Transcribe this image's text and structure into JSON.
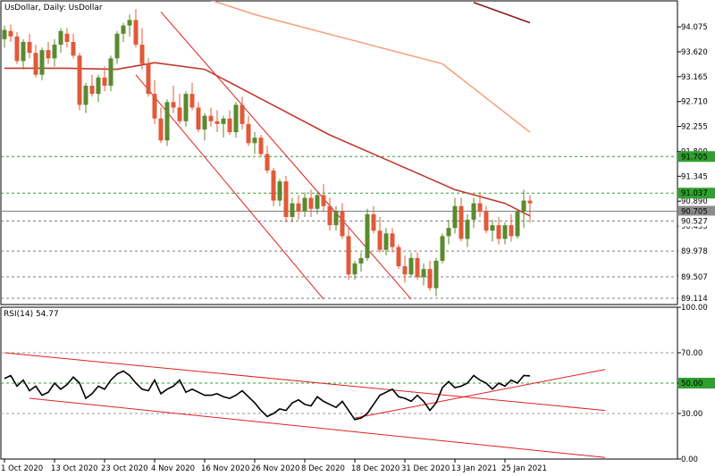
{
  "chart_data": [
    {
      "type": "candlestick",
      "title": "UsDollar, Daily:  UsDollar",
      "ylim": [
        89.0,
        94.55
      ],
      "y_ticks": [
        "94.075",
        "93.620",
        "93.165",
        "92.710",
        "92.255",
        "91.800",
        "91.345",
        "90.890",
        "90.435",
        "89.980",
        "89.525",
        "89.114"
      ],
      "price_labels": [
        {
          "label": "91.705",
          "style": "green-box"
        },
        {
          "label": "91.037",
          "style": "green-box"
        },
        {
          "label": "90.705",
          "style": "gray-box"
        },
        {
          "label": "90.527",
          "style": "plain"
        },
        {
          "label": "89.978",
          "style": "plain"
        },
        {
          "label": "89.507",
          "style": "plain"
        },
        {
          "label": "89.114",
          "style": "plain"
        }
      ],
      "x_ticks": [
        "1 Oct 2020",
        "13 Oct 2020",
        "23 Oct 2020",
        "4 Nov 2020",
        "16 Nov 2020",
        "26 Nov 2020",
        "8 Dec 2020",
        "18 Dec 2020",
        "31 Dec 2020",
        "13 Jan 2021",
        "25 Jan 2021"
      ],
      "tick_indices": [
        0,
        8,
        16,
        24,
        32,
        40,
        48,
        56,
        64,
        72,
        80
      ],
      "up_color": "#5a8a2f",
      "down_color": "#e05a3a",
      "candles": [
        [
          93.85,
          94.1,
          93.7,
          94.02
        ],
        [
          94.0,
          94.12,
          93.8,
          93.9
        ],
        [
          93.9,
          93.98,
          93.4,
          93.45
        ],
        [
          93.45,
          93.85,
          93.3,
          93.8
        ],
        [
          93.8,
          93.95,
          93.5,
          93.6
        ],
        [
          93.6,
          93.75,
          93.15,
          93.2
        ],
        [
          93.2,
          93.7,
          93.1,
          93.65
        ],
        [
          93.65,
          93.8,
          93.4,
          93.5
        ],
        [
          93.5,
          93.85,
          93.35,
          93.75
        ],
        [
          93.75,
          94.05,
          93.6,
          94.0
        ],
        [
          93.95,
          94.05,
          93.7,
          93.8
        ],
        [
          93.8,
          93.95,
          93.5,
          93.55
        ],
        [
          93.55,
          93.6,
          92.55,
          92.65
        ],
        [
          92.65,
          93.05,
          92.5,
          93.0
        ],
        [
          93.0,
          93.2,
          92.8,
          92.85
        ],
        [
          92.85,
          93.2,
          92.7,
          93.15
        ],
        [
          93.15,
          93.35,
          92.9,
          93.0
        ],
        [
          93.0,
          93.55,
          92.9,
          93.5
        ],
        [
          93.5,
          94.0,
          93.4,
          93.95
        ],
        [
          93.95,
          94.15,
          93.8,
          94.1
        ],
        [
          94.1,
          94.3,
          93.9,
          94.2
        ],
        [
          94.2,
          94.4,
          93.7,
          93.75
        ],
        [
          93.75,
          94.05,
          93.3,
          93.4
        ],
        [
          93.4,
          93.5,
          92.8,
          92.85
        ],
        [
          92.85,
          93.1,
          92.3,
          92.4
        ],
        [
          92.4,
          92.6,
          91.95,
          92.0
        ],
        [
          92.0,
          92.75,
          91.9,
          92.7
        ],
        [
          92.7,
          93.0,
          92.5,
          92.6
        ],
        [
          92.6,
          92.85,
          92.3,
          92.35
        ],
        [
          92.35,
          92.9,
          92.25,
          92.85
        ],
        [
          92.85,
          93.05,
          92.55,
          92.6
        ],
        [
          92.6,
          92.7,
          92.15,
          92.2
        ],
        [
          92.2,
          92.5,
          92.0,
          92.45
        ],
        [
          92.45,
          92.6,
          92.25,
          92.35
        ],
        [
          92.35,
          92.55,
          92.15,
          92.3
        ],
        [
          92.3,
          92.45,
          92.05,
          92.4
        ],
        [
          92.4,
          92.55,
          92.1,
          92.15
        ],
        [
          92.15,
          92.7,
          92.05,
          92.65
        ],
        [
          92.65,
          92.8,
          92.2,
          92.3
        ],
        [
          92.3,
          92.45,
          91.9,
          91.95
        ],
        [
          91.95,
          92.15,
          91.75,
          92.05
        ],
        [
          92.05,
          92.1,
          91.7,
          91.75
        ],
        [
          91.75,
          91.9,
          91.4,
          91.45
        ],
        [
          91.45,
          91.5,
          90.8,
          90.9
        ],
        [
          90.9,
          91.3,
          90.8,
          91.25
        ],
        [
          91.25,
          91.35,
          90.5,
          90.6
        ],
        [
          90.6,
          90.95,
          90.5,
          90.85
        ],
        [
          90.85,
          91.0,
          90.55,
          90.7
        ],
        [
          90.7,
          91.05,
          90.6,
          90.95
        ],
        [
          90.95,
          91.1,
          90.6,
          90.75
        ],
        [
          90.75,
          91.05,
          90.65,
          91.0
        ],
        [
          91.0,
          91.2,
          90.7,
          90.8
        ],
        [
          90.8,
          90.95,
          90.35,
          90.45
        ],
        [
          90.45,
          90.8,
          90.35,
          90.7
        ],
        [
          90.7,
          90.85,
          90.2,
          90.25
        ],
        [
          90.25,
          90.4,
          89.45,
          89.55
        ],
        [
          89.55,
          89.8,
          89.45,
          89.75
        ],
        [
          89.75,
          89.95,
          89.6,
          89.85
        ],
        [
          89.85,
          90.75,
          89.8,
          90.65
        ],
        [
          90.65,
          90.8,
          90.3,
          90.35
        ],
        [
          90.35,
          90.6,
          89.95,
          90.0
        ],
        [
          90.0,
          90.4,
          89.9,
          90.3
        ],
        [
          90.3,
          90.4,
          89.95,
          90.05
        ],
        [
          90.05,
          90.1,
          89.65,
          89.7
        ],
        [
          89.7,
          89.9,
          89.4,
          89.55
        ],
        [
          89.55,
          89.95,
          89.5,
          89.85
        ],
        [
          89.85,
          89.95,
          89.45,
          89.5
        ],
        [
          89.5,
          89.75,
          89.35,
          89.65
        ],
        [
          89.65,
          89.8,
          89.25,
          89.3
        ],
        [
          89.3,
          89.85,
          89.15,
          89.8
        ],
        [
          89.8,
          90.3,
          89.75,
          90.25
        ],
        [
          90.25,
          90.55,
          90.1,
          90.4
        ],
        [
          90.4,
          90.95,
          90.3,
          90.8
        ],
        [
          90.8,
          90.95,
          90.15,
          90.2
        ],
        [
          90.2,
          90.65,
          90.05,
          90.55
        ],
        [
          90.55,
          90.95,
          90.4,
          90.85
        ],
        [
          90.85,
          91.05,
          90.6,
          90.7
        ],
        [
          90.7,
          90.8,
          90.3,
          90.35
        ],
        [
          90.35,
          90.55,
          90.15,
          90.45
        ],
        [
          90.45,
          90.6,
          90.1,
          90.2
        ],
        [
          90.2,
          90.5,
          90.1,
          90.45
        ],
        [
          90.45,
          90.65,
          90.15,
          90.25
        ],
        [
          90.25,
          90.75,
          90.2,
          90.7
        ],
        [
          90.7,
          91.1,
          90.4,
          90.9
        ],
        [
          90.9,
          91.0,
          90.5,
          90.85
        ]
      ],
      "moving_averages": [
        {
          "color": "#f4a582",
          "points": [
            [
              0,
              95.4
            ],
            [
              20,
              95.05
            ],
            [
              40,
              94.3
            ],
            [
              55,
              93.85
            ],
            [
              70,
              93.4
            ],
            [
              84,
              92.15
            ]
          ]
        },
        {
          "color": "#c0392b",
          "points": [
            [
              0,
              93.32
            ],
            [
              10,
              93.32
            ],
            [
              18,
              93.3
            ],
            [
              24,
              93.42
            ],
            [
              32,
              93.3
            ],
            [
              42,
              92.7
            ],
            [
              52,
              92.1
            ],
            [
              62,
              91.6
            ],
            [
              72,
              91.1
            ],
            [
              80,
              90.85
            ],
            [
              84,
              90.62
            ]
          ]
        },
        {
          "color": "#8b1a1a",
          "points": [
            [
              75,
              94.52
            ],
            [
              84,
              94.15
            ]
          ]
        }
      ],
      "trend_lines": [
        {
          "color": "#e02020",
          "points": [
            [
              21,
              93.2
            ],
            [
              51,
              89.1
            ]
          ]
        },
        {
          "color": "#e02020",
          "points": [
            [
              25,
              94.35
            ],
            [
              65,
              89.1
            ]
          ]
        }
      ],
      "hlines": [
        {
          "value": 91.705,
          "color": "#2ea02e",
          "dash": true
        },
        {
          "value": 91.037,
          "color": "#2ea02e",
          "dash": true
        },
        {
          "value": 90.705,
          "color": "#7f7f7f",
          "dash": false
        },
        {
          "value": 90.527,
          "color": "#7f7f7f",
          "dash": true
        },
        {
          "value": 89.978,
          "color": "#7f7f7f",
          "dash": true
        },
        {
          "value": 89.507,
          "color": "#7f7f7f",
          "dash": true
        },
        {
          "value": 89.114,
          "color": "#7f7f7f",
          "dash": true
        }
      ]
    },
    {
      "type": "line",
      "title": "RSI(14) 54.77",
      "ylim": [
        0,
        100
      ],
      "y_ticks": [
        "100.00",
        "70.00",
        "50.00",
        "30.00",
        "0.00"
      ],
      "levels": [
        {
          "value": 70,
          "label": "70.00",
          "color": "#9a9a9a"
        },
        {
          "value": 50,
          "label": "50.00",
          "color": "#2ea02e",
          "boxed": true
        },
        {
          "value": 30,
          "label": "30.00",
          "color": "#9a9a9a"
        }
      ],
      "rsi_values": [
        53,
        55,
        48,
        52,
        45,
        48,
        42,
        44,
        50,
        46,
        49,
        54,
        50,
        40,
        43,
        48,
        46,
        52,
        56,
        58,
        55,
        50,
        46,
        45,
        52,
        43,
        46,
        48,
        52,
        44,
        46,
        44,
        42,
        42,
        43,
        41,
        40,
        42,
        45,
        41,
        37,
        32,
        28,
        30,
        33,
        32,
        37,
        39,
        36,
        35,
        41,
        38,
        36,
        34,
        38,
        32,
        26,
        27,
        30,
        36,
        42,
        44,
        46,
        41,
        40,
        38,
        42,
        38,
        32,
        37,
        47,
        51,
        47,
        48,
        50,
        55,
        52,
        50,
        46,
        50,
        48,
        52,
        50,
        55,
        54.77
      ],
      "trend_lines": [
        {
          "color": "#e02020",
          "points": [
            [
              0,
              70
            ],
            [
              96,
              32
            ]
          ]
        },
        {
          "color": "#e02020",
          "points": [
            [
              4,
              40
            ],
            [
              96,
              1
            ]
          ]
        },
        {
          "color": "#e02020",
          "points": [
            [
              56,
              27
            ],
            [
              96,
              59
            ]
          ]
        }
      ]
    }
  ]
}
